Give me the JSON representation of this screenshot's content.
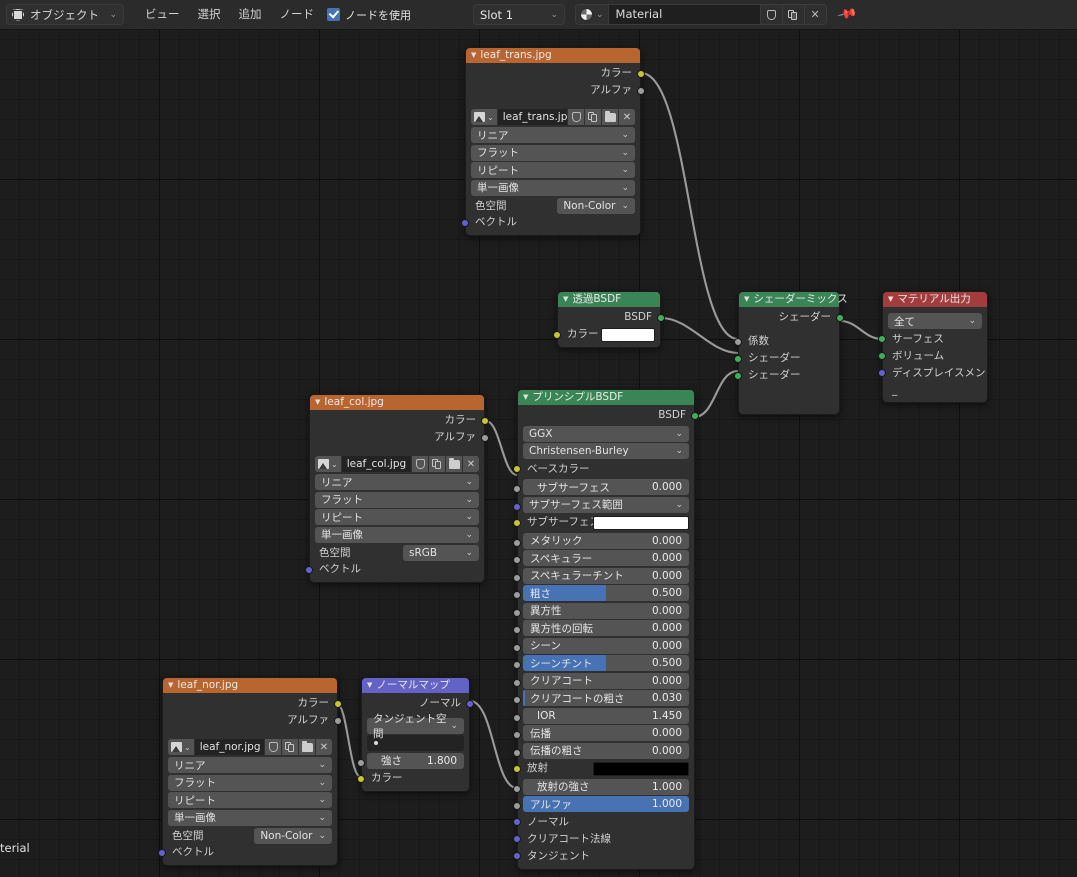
{
  "header": {
    "mode_selector": {
      "label": "オブジェクト",
      "icon": "object-mode-icon",
      "chevron": "⌄"
    },
    "menus": [
      "ビュー",
      "選択",
      "追加",
      "ノード"
    ],
    "use_nodes": {
      "label": "ノードを使用",
      "checked": true
    },
    "slot": {
      "label": "Slot 1",
      "chevron": "⌄"
    },
    "material": {
      "icon": "material-sphere-icon",
      "name": "Material",
      "buttons": [
        "shield-icon",
        "copy-icon",
        "close-icon"
      ],
      "chevron": "⌄"
    },
    "pin_icon": "pin-icon"
  },
  "canvas": {
    "overflow_label": "terial"
  },
  "nodes": {
    "leaf_trans": {
      "title": "leaf_trans.jpg",
      "outputs": [
        "カラー",
        "アルファ"
      ],
      "image_name": "leaf_trans.jpg",
      "dropdowns": [
        "リニア",
        "フラット",
        "リピート",
        "単一画像"
      ],
      "colorspace_label": "色空間",
      "colorspace_value": "Non-Color",
      "inputs": [
        "ベクトル"
      ]
    },
    "transparent_bsdf": {
      "title": "透過BSDF",
      "outputs": [
        "BSDF"
      ],
      "color_label": "カラー",
      "color_value": "#ffffff"
    },
    "mix_shader": {
      "title": "シェーダーミックス",
      "outputs": [
        "シェーダー"
      ],
      "inputs": [
        "係数",
        "シェーダー",
        "シェーダー"
      ]
    },
    "material_output": {
      "title": "マテリアル出力",
      "target": "全て",
      "inputs": [
        "サーフェス",
        "ボリューム",
        "ディスプレイスメン_"
      ]
    },
    "leaf_col": {
      "title": "leaf_col.jpg",
      "outputs": [
        "カラー",
        "アルファ"
      ],
      "image_name": "leaf_col.jpg",
      "dropdowns": [
        "リニア",
        "フラット",
        "リピート",
        "単一画像"
      ],
      "colorspace_label": "色空間",
      "colorspace_value": "sRGB",
      "inputs": [
        "ベクトル"
      ]
    },
    "principled_bsdf": {
      "title": "プリンシプルBSDF",
      "outputs": [
        "BSDF"
      ],
      "distribution": "GGX",
      "subsurface_method": "Christensen-Burley",
      "sockets": [
        {
          "name": "ベースカラー",
          "type": "label",
          "color": "yellow"
        },
        {
          "name": "サブサーフェス",
          "type": "value",
          "value": "0.000",
          "fill": 0,
          "color": "grey",
          "sub": true
        },
        {
          "name": "サブサーフェス範囲",
          "type": "dropdown",
          "color": "purple"
        },
        {
          "name": "サブサーフェス_",
          "type": "swatch",
          "swatch": "#ffffff",
          "color": "yellow"
        },
        {
          "name": "メタリック",
          "type": "value",
          "value": "0.000",
          "fill": 0,
          "color": "grey"
        },
        {
          "name": "スペキュラー",
          "type": "value",
          "value": "0.000",
          "fill": 0,
          "color": "grey"
        },
        {
          "name": "スペキュラーチント",
          "type": "value",
          "value": "0.000",
          "fill": 0,
          "color": "grey"
        },
        {
          "name": "粗さ",
          "type": "value",
          "value": "0.500",
          "fill": 50,
          "color": "grey"
        },
        {
          "name": "異方性",
          "type": "value",
          "value": "0.000",
          "fill": 0,
          "color": "grey"
        },
        {
          "name": "異方性の回転",
          "type": "value",
          "value": "0.000",
          "fill": 0,
          "color": "grey"
        },
        {
          "name": "シーン",
          "type": "value",
          "value": "0.000",
          "fill": 0,
          "color": "grey"
        },
        {
          "name": "シーンチント",
          "type": "value",
          "value": "0.500",
          "fill": 50,
          "color": "grey"
        },
        {
          "name": "クリアコート",
          "type": "value",
          "value": "0.000",
          "fill": 0,
          "color": "grey"
        },
        {
          "name": "クリアコートの粗さ",
          "type": "value",
          "value": "0.030",
          "fill": 3,
          "color": "grey"
        },
        {
          "name": "IOR",
          "type": "value",
          "value": "1.450",
          "fill": 0,
          "color": "grey",
          "sub": true
        },
        {
          "name": "伝播",
          "type": "value",
          "value": "0.000",
          "fill": 0,
          "color": "grey"
        },
        {
          "name": "伝播の粗さ",
          "type": "value",
          "value": "0.000",
          "fill": 0,
          "color": "grey"
        },
        {
          "name": "放射",
          "type": "swatch",
          "swatch": "#000000",
          "color": "yellow"
        },
        {
          "name": "放射の強さ",
          "type": "value",
          "value": "1.000",
          "fill": 0,
          "color": "grey",
          "sub": true
        },
        {
          "name": "アルファ",
          "type": "value",
          "value": "1.000",
          "fill": 100,
          "color": "grey"
        },
        {
          "name": "ノーマル",
          "type": "label",
          "color": "purple"
        },
        {
          "name": "クリアコート法線",
          "type": "label",
          "color": "purple"
        },
        {
          "name": "タンジェント",
          "type": "label",
          "color": "purple"
        }
      ]
    },
    "leaf_nor": {
      "title": "leaf_nor.jpg",
      "outputs": [
        "カラー",
        "アルファ"
      ],
      "image_name": "leaf_nor.jpg",
      "dropdowns": [
        "リニア",
        "フラット",
        "リピート",
        "単一画像"
      ],
      "colorspace_label": "色空間",
      "colorspace_value": "Non-Color",
      "inputs": [
        "ベクトル"
      ]
    },
    "normal_map": {
      "title": "ノーマルマップ",
      "outputs": [
        "ノーマル"
      ],
      "space": "タンジェント空間",
      "uv_map": "",
      "strength_label": "強さ",
      "strength_value": "1.800",
      "inputs": [
        "カラー"
      ]
    }
  },
  "colors": {
    "texture_header": "#b9652f",
    "shader_header": "#3a8556",
    "output_header": "#a33c3c",
    "vector_header": "#6363c7",
    "node_body": "#303030",
    "widget": "#545454",
    "accent_blue": "#4772b3",
    "socket_yellow": "#c7c729",
    "socket_grey": "#9d9d9d",
    "socket_green": "#3fb05a",
    "socket_purple": "#6262d4",
    "wire": "#9a9a9a"
  }
}
